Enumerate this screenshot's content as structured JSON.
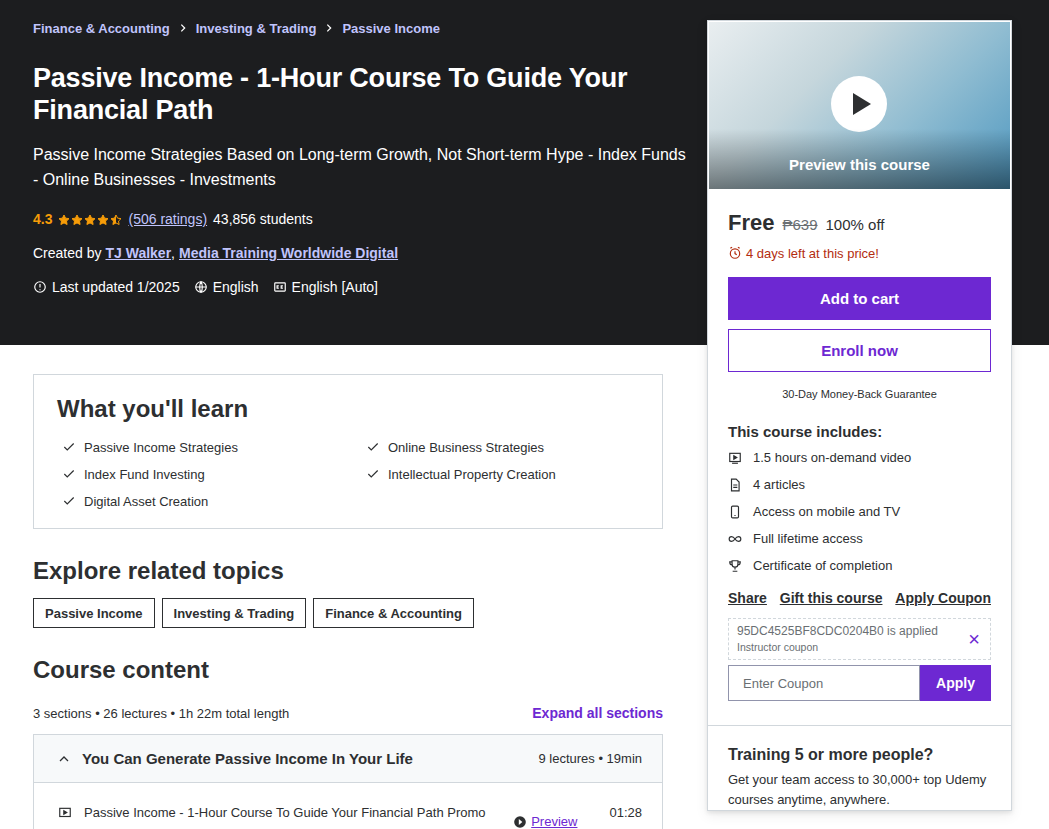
{
  "breadcrumb": [
    {
      "label": "Finance & Accounting"
    },
    {
      "label": "Investing & Trading"
    },
    {
      "label": "Passive Income"
    }
  ],
  "course": {
    "title": "Passive Income - 1-Hour Course To Guide Your Financial Path",
    "subtitle": "Passive Income Strategies Based on Long-term Growth, Not Short-term Hype - Index Funds - Online Businesses - Investments",
    "rating": "4.3",
    "stars": 4.5,
    "ratings_count": "(506 ratings)",
    "students": "43,856 students",
    "created_by": "Created by",
    "authors": [
      "TJ Walker",
      "Media Training Worldwide Digital"
    ],
    "author_separator": ",",
    "last_updated": "Last updated 1/2025",
    "language": "English",
    "captions": "English [Auto]"
  },
  "sidebar": {
    "preview_label": "Preview this course",
    "price": "Free",
    "original_price": "₱639",
    "discount": "100% off",
    "urgency": "4 days left at this price!",
    "add_to_cart": "Add to cart",
    "enroll": "Enroll now",
    "guarantee": "30-Day Money-Back Guarantee",
    "includes_title": "This course includes:",
    "includes": [
      {
        "label": "1.5 hours on-demand video",
        "kind": "video"
      },
      {
        "label": "4 articles",
        "kind": "article"
      },
      {
        "label": "Access on mobile and TV",
        "kind": "mobile"
      },
      {
        "label": "Full lifetime access",
        "kind": "lifetime"
      },
      {
        "label": "Certificate of completion",
        "kind": "certificate"
      }
    ],
    "actions": [
      "Share",
      "Gift this course",
      "Apply Coupon"
    ],
    "coupon": {
      "code": "95DC4525BF8CDC0204B0",
      "status": "is applied",
      "note": "Instructor coupon",
      "remove": "×"
    },
    "coupon_input": {
      "placeholder": "Enter Coupon"
    },
    "apply": "Apply",
    "team": {
      "title": "Training 5 or more people?",
      "text": "Get your team access to 30,000+ top Udemy courses anytime, anywhere."
    }
  },
  "learn": {
    "title": "What you'll learn",
    "items": [
      "Passive Income Strategies",
      "Online Business Strategies",
      "Index Fund Investing",
      "Intellectual Property Creation",
      "Digital Asset Creation"
    ]
  },
  "related": {
    "title": "Explore related topics",
    "tags": [
      "Passive Income",
      "Investing & Trading",
      "Finance & Accounting"
    ]
  },
  "content": {
    "title": "Course content",
    "summary": "3 sections • 26 lectures • 1h 22m total length",
    "expand": "Expand all sections",
    "sections": [
      {
        "title": "You Can Generate Passive Income In Your Life",
        "meta": "9 lectures • 19min",
        "expanded": true,
        "lectures": [
          {
            "title": "Passive Income - 1-Hour Course To Guide Your Financial Path Promo",
            "preview": "Preview",
            "duration": "01:28"
          }
        ]
      }
    ]
  }
}
